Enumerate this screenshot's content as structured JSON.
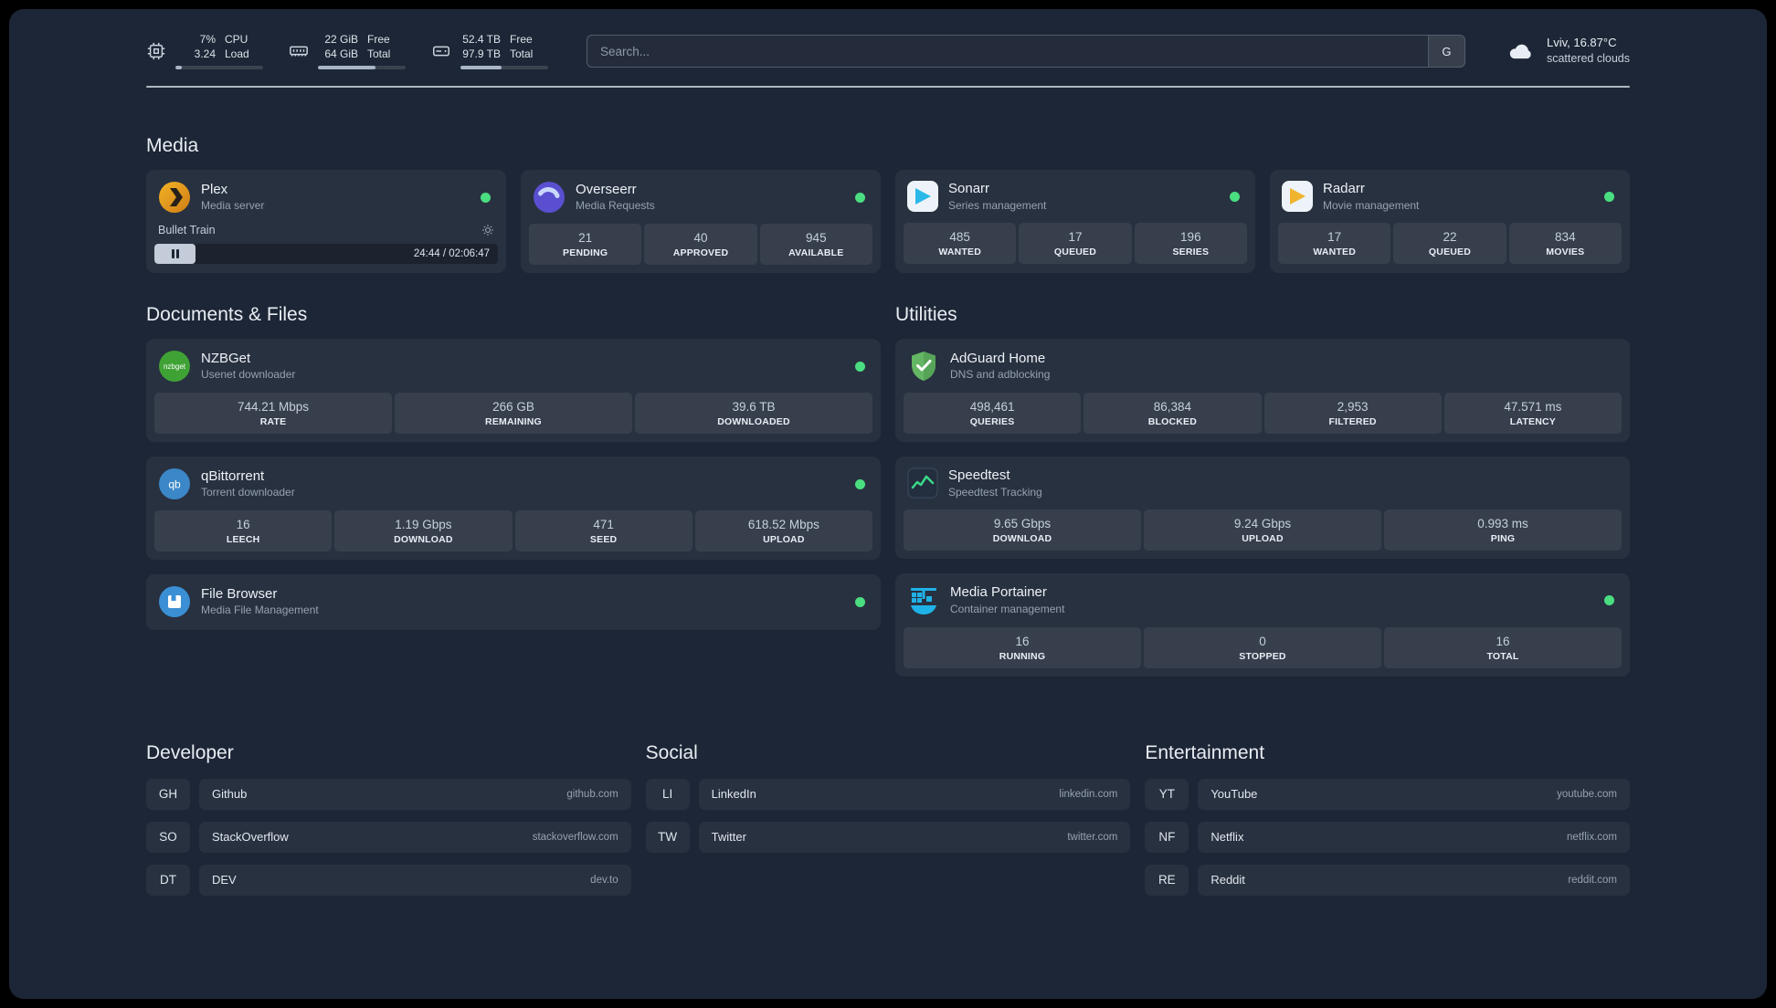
{
  "colors": {
    "online": "#4ade80",
    "page_bg": "#1d2636"
  },
  "topbar": {
    "widgets": [
      {
        "values": [
          "7%",
          "3.24"
        ],
        "labels": [
          "CPU",
          "Load"
        ],
        "progress": "7%"
      },
      {
        "values": [
          "22 GiB",
          "64 GiB"
        ],
        "labels": [
          "Free",
          "Total"
        ],
        "progress": "66%"
      },
      {
        "values": [
          "52.4 TB",
          "97.9 TB"
        ],
        "labels": [
          "Free",
          "Total"
        ],
        "progress": "47%"
      }
    ],
    "search": {
      "placeholder": "Search...",
      "button_label": "G"
    },
    "weather": {
      "location": "Lviv, 16.87°C",
      "condition": "scattered clouds"
    }
  },
  "groups": {
    "media": {
      "title": "Media",
      "services": [
        {
          "name": "Plex",
          "description": "Media server",
          "player": {
            "title": "Bullet Train",
            "time": "24:44 / 02:06:47",
            "progress": "12%"
          }
        },
        {
          "name": "Overseerr",
          "description": "Media Requests",
          "stats": [
            {
              "value": "21",
              "label": "PENDING"
            },
            {
              "value": "40",
              "label": "APPROVED"
            },
            {
              "value": "945",
              "label": "AVAILABLE"
            }
          ]
        },
        {
          "name": "Sonarr",
          "description": "Series management",
          "stats": [
            {
              "value": "485",
              "label": "WANTED"
            },
            {
              "value": "17",
              "label": "QUEUED"
            },
            {
              "value": "196",
              "label": "SERIES"
            }
          ]
        },
        {
          "name": "Radarr",
          "description": "Movie management",
          "stats": [
            {
              "value": "17",
              "label": "WANTED"
            },
            {
              "value": "22",
              "label": "QUEUED"
            },
            {
              "value": "834",
              "label": "MOVIES"
            }
          ]
        }
      ]
    },
    "documents": {
      "title": "Documents & Files",
      "services": [
        {
          "name": "NZBGet",
          "description": "Usenet downloader",
          "stats": [
            {
              "value": "744.21 Mbps",
              "label": "RATE"
            },
            {
              "value": "266 GB",
              "label": "REMAINING"
            },
            {
              "value": "39.6 TB",
              "label": "DOWNLOADED"
            }
          ]
        },
        {
          "name": "qBittorrent",
          "description": "Torrent downloader",
          "stats": [
            {
              "value": "16",
              "label": "LEECH"
            },
            {
              "value": "1.19 Gbps",
              "label": "DOWNLOAD"
            },
            {
              "value": "471",
              "label": "SEED"
            },
            {
              "value": "618.52 Mbps",
              "label": "UPLOAD"
            }
          ]
        },
        {
          "name": "File Browser",
          "description": "Media File Management",
          "stats": []
        }
      ]
    },
    "utilities": {
      "title": "Utilities",
      "services": [
        {
          "name": "AdGuard Home",
          "description": "DNS and adblocking",
          "stats": [
            {
              "value": "498,461",
              "label": "QUERIES"
            },
            {
              "value": "86,384",
              "label": "BLOCKED"
            },
            {
              "value": "2,953",
              "label": "FILTERED"
            },
            {
              "value": "47.571 ms",
              "label": "LATENCY"
            }
          ]
        },
        {
          "name": "Speedtest",
          "description": "Speedtest Tracking",
          "stats": [
            {
              "value": "9.65 Gbps",
              "label": "DOWNLOAD"
            },
            {
              "value": "9.24 Gbps",
              "label": "UPLOAD"
            },
            {
              "value": "0.993 ms",
              "label": "PING"
            }
          ]
        },
        {
          "name": "Media Portainer",
          "description": "Container management",
          "stats": [
            {
              "value": "16",
              "label": "RUNNING"
            },
            {
              "value": "0",
              "label": "STOPPED"
            },
            {
              "value": "16",
              "label": "TOTAL"
            }
          ]
        }
      ]
    }
  },
  "bookmarks": [
    {
      "title": "Developer",
      "items": [
        {
          "abbr": "GH",
          "name": "Github",
          "url": "github.com"
        },
        {
          "abbr": "SO",
          "name": "StackOverflow",
          "url": "stackoverflow.com"
        },
        {
          "abbr": "DT",
          "name": "DEV",
          "url": "dev.to"
        }
      ]
    },
    {
      "title": "Social",
      "items": [
        {
          "abbr": "LI",
          "name": "LinkedIn",
          "url": "linkedin.com"
        },
        {
          "abbr": "TW",
          "name": "Twitter",
          "url": "twitter.com"
        }
      ]
    },
    {
      "title": "Entertainment",
      "items": [
        {
          "abbr": "YT",
          "name": "YouTube",
          "url": "youtube.com"
        },
        {
          "abbr": "NF",
          "name": "Netflix",
          "url": "netflix.com"
        },
        {
          "abbr": "RE",
          "name": "Reddit",
          "url": "reddit.com"
        }
      ]
    }
  ]
}
